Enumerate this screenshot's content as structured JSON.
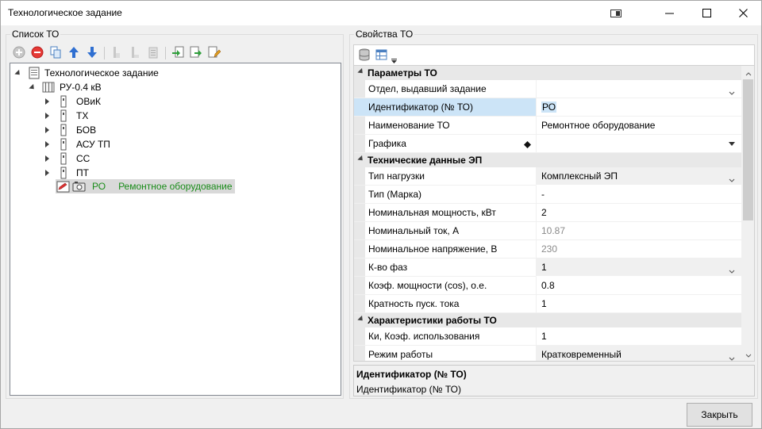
{
  "window": {
    "title": "Технологическое задание"
  },
  "left_panel": {
    "label": "Список ТО",
    "tree": {
      "root": "Технологическое задание",
      "switchboard": "РУ-0.4 кВ",
      "groups": [
        "ОВиК",
        "ТХ",
        "БОВ",
        "АСУ ТП",
        "СС",
        "ПТ"
      ],
      "selected_item": {
        "code": "РО",
        "name": "Ремонтное оборудование"
      }
    }
  },
  "right_panel": {
    "label": "Свойства ТО",
    "categories": {
      "params": "Параметры ТО",
      "tech": "Технические данные ЭП",
      "work": "Характеристики работы ТО"
    },
    "rows": {
      "department": {
        "name": "Отдел, выдавший задание",
        "value": ""
      },
      "identifier": {
        "name": "Идентификатор (№ ТО)",
        "value": "РО"
      },
      "title": {
        "name": "Наименование ТО",
        "value": "Ремонтное оборудование"
      },
      "graphics": {
        "name": "Графика",
        "value": ""
      },
      "load_type": {
        "name": "Тип нагрузки",
        "value": "Комплексный ЭП"
      },
      "brand": {
        "name": "Тип (Марка)",
        "value": "-"
      },
      "power": {
        "name": "Номинальная мощность, кВт",
        "value": "2"
      },
      "current": {
        "name": "Номинальный ток, А",
        "value": "10.87"
      },
      "voltage": {
        "name": "Номинальное напряжение, В",
        "value": "230"
      },
      "phases": {
        "name": "К-во фаз",
        "value": "1"
      },
      "cos": {
        "name": "Коэф. мощности (cos), о.е.",
        "value": "0.8"
      },
      "start": {
        "name": "Кратность пуск. тока",
        "value": "1"
      },
      "ki": {
        "name": "Ки, Коэф. использования",
        "value": "1"
      },
      "mode": {
        "name": "Режим работы",
        "value": "Кратковременный"
      }
    },
    "description": {
      "title": "Идентификатор (№ ТО)",
      "text": "Идентификатор (№ ТО)"
    }
  },
  "buttons": {
    "close": "Закрыть"
  },
  "colors": {
    "selection": "#cce4f7",
    "tree_selected_name": "#1a8c1a",
    "category_bg": "#e8e8e8"
  }
}
